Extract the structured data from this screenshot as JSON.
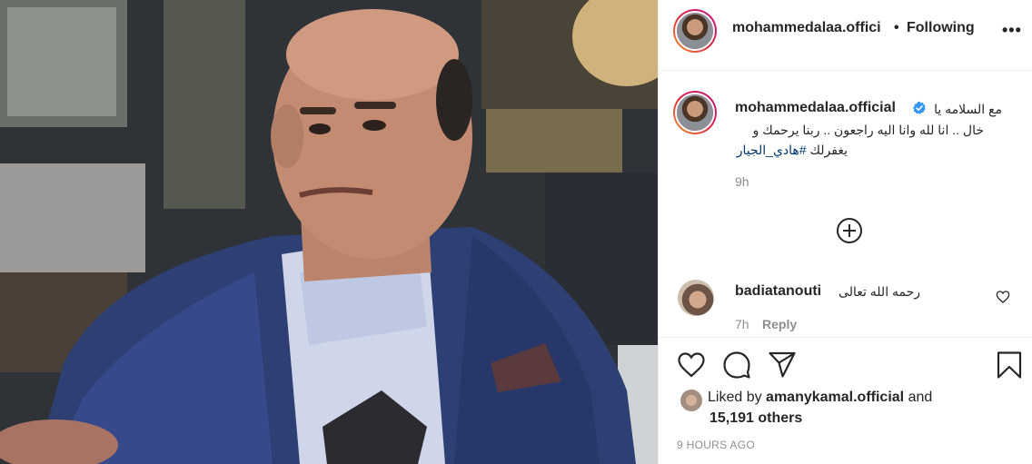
{
  "post": {
    "header": {
      "username": "mohammedalaa.offici",
      "separator": "•",
      "follow_status": "Following",
      "more_label": "•••"
    },
    "caption": {
      "username": "mohammedalaa.official",
      "line1": "مع السلامه يا",
      "line2": "خال .. انا لله وانا اليه راجعون .. ربنا يرحمك و",
      "line3_text": "يغفرلك",
      "hashtag": "#هادي_الجيار",
      "time": "9h"
    },
    "comment": {
      "username": "badiatanouti",
      "text": "رحمه الله تعالى",
      "time": "7h",
      "reply_label": "Reply"
    },
    "likes": {
      "prefix": "Liked by",
      "user": "amanykamal.official",
      "and": "and",
      "others": "15,191 others"
    },
    "timestamp": "9 HOURS AGO"
  },
  "icons": [
    "verified-icon",
    "add-comment-icon",
    "heart-icon",
    "comment-icon",
    "share-icon",
    "save-icon"
  ],
  "colors": {
    "link": "#00376b",
    "muted": "#8e8e8e",
    "verified": "#3897f0"
  }
}
